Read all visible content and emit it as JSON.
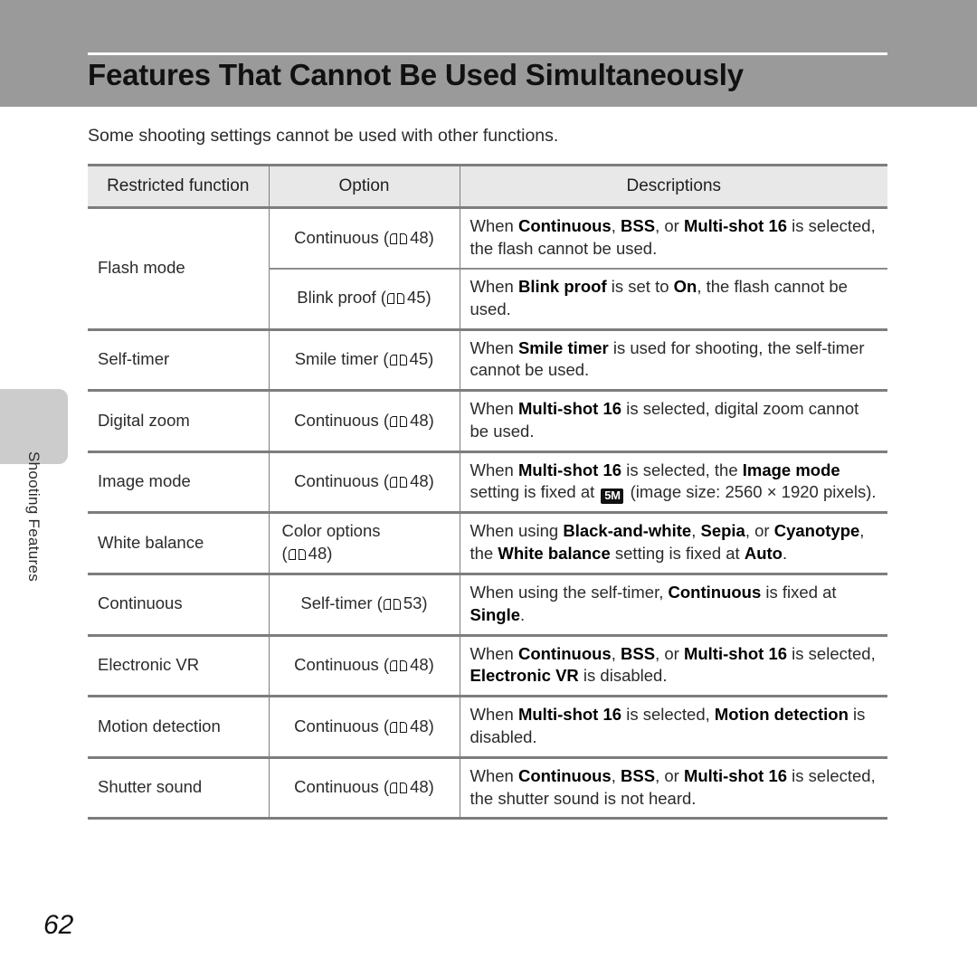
{
  "header": {
    "title": "Features That Cannot Be Used Simultaneously"
  },
  "intro": "Some shooting settings cannot be used with other functions.",
  "side_tab": {
    "label": "Shooting Features"
  },
  "footer": {
    "page_number": "62"
  },
  "table": {
    "columns": [
      "Restricted function",
      "Option",
      "Descriptions"
    ],
    "rows": [
      {
        "function": "Flash mode",
        "option_prefix": "Continuous (",
        "option_icon": "book-icon",
        "option_page": "48",
        "option_suffix": ")",
        "description_parts": [
          {
            "text": "When ",
            "bold": false
          },
          {
            "text": "Continuous",
            "bold": true
          },
          {
            "text": ", ",
            "bold": false
          },
          {
            "text": "BSS",
            "bold": true
          },
          {
            "text": ", or ",
            "bold": false
          },
          {
            "text": "Multi-shot 16",
            "bold": true
          },
          {
            "text": " is selected, the flash cannot be used.",
            "bold": false
          }
        ]
      },
      {
        "function": "",
        "option_prefix": "Blink proof (",
        "option_icon": "book-icon",
        "option_page": "45",
        "option_suffix": ")",
        "description_parts": [
          {
            "text": "When ",
            "bold": false
          },
          {
            "text": "Blink proof",
            "bold": true
          },
          {
            "text": " is set to ",
            "bold": false
          },
          {
            "text": "On",
            "bold": true
          },
          {
            "text": ", the flash cannot be used.",
            "bold": false
          }
        ]
      },
      {
        "function": "Self-timer",
        "option_prefix": "Smile timer (",
        "option_icon": "book-icon",
        "option_page": "45",
        "option_suffix": ")",
        "description_parts": [
          {
            "text": "When ",
            "bold": false
          },
          {
            "text": "Smile timer",
            "bold": true
          },
          {
            "text": " is used for shooting, the self-timer cannot be used.",
            "bold": false
          }
        ]
      },
      {
        "function": "Digital zoom",
        "option_prefix": "Continuous (",
        "option_icon": "book-icon",
        "option_page": "48",
        "option_suffix": ")",
        "description_parts": [
          {
            "text": "When ",
            "bold": false
          },
          {
            "text": "Multi-shot 16",
            "bold": true
          },
          {
            "text": " is selected, digital zoom cannot be used.",
            "bold": false
          }
        ]
      },
      {
        "function": "Image mode",
        "option_prefix": "Continuous (",
        "option_icon": "book-icon",
        "option_page": "48",
        "option_suffix": ")",
        "description_parts": [
          {
            "text": "When ",
            "bold": false
          },
          {
            "text": "Multi-shot 16",
            "bold": true
          },
          {
            "text": " is selected, the ",
            "bold": false
          },
          {
            "text": "Image mode",
            "bold": true
          },
          {
            "text": " setting is fixed at ",
            "bold": false
          },
          {
            "badge": "5M"
          },
          {
            "text": " (image size: 2560 × 1920 pixels).",
            "bold": false
          }
        ]
      },
      {
        "function": "White balance",
        "option_prefix": "Color options",
        "option_icon": "book-icon",
        "option_page": "48",
        "option_suffix": "",
        "option_wrapped": true,
        "description_parts": [
          {
            "text": "When using ",
            "bold": false
          },
          {
            "text": "Black-and-white",
            "bold": true
          },
          {
            "text": ", ",
            "bold": false
          },
          {
            "text": "Sepia",
            "bold": true
          },
          {
            "text": ", or ",
            "bold": false
          },
          {
            "text": "Cyanotype",
            "bold": true
          },
          {
            "text": ", the ",
            "bold": false
          },
          {
            "text": "White balance",
            "bold": true
          },
          {
            "text": " setting is fixed at ",
            "bold": false
          },
          {
            "text": "Auto",
            "bold": true
          },
          {
            "text": ".",
            "bold": false
          }
        ]
      },
      {
        "function": "Continuous",
        "option_prefix": "Self-timer (",
        "option_icon": "book-icon",
        "option_page": "53",
        "option_suffix": ")",
        "description_parts": [
          {
            "text": "When using the self-timer, ",
            "bold": false
          },
          {
            "text": "Continuous",
            "bold": true
          },
          {
            "text": " is fixed at ",
            "bold": false
          },
          {
            "text": "Single",
            "bold": true
          },
          {
            "text": ".",
            "bold": false
          }
        ]
      },
      {
        "function": "Electronic VR",
        "option_prefix": "Continuous (",
        "option_icon": "book-icon",
        "option_page": "48",
        "option_suffix": ")",
        "description_parts": [
          {
            "text": "When ",
            "bold": false
          },
          {
            "text": "Continuous",
            "bold": true
          },
          {
            "text": ", ",
            "bold": false
          },
          {
            "text": "BSS",
            "bold": true
          },
          {
            "text": ", or ",
            "bold": false
          },
          {
            "text": "Multi-shot 16",
            "bold": true
          },
          {
            "text": " is selected, ",
            "bold": false
          },
          {
            "text": "Electronic VR",
            "bold": true
          },
          {
            "text": " is disabled.",
            "bold": false
          }
        ]
      },
      {
        "function": "Motion detection",
        "option_prefix": "Continuous (",
        "option_icon": "book-icon",
        "option_page": "48",
        "option_suffix": ")",
        "description_parts": [
          {
            "text": "When ",
            "bold": false
          },
          {
            "text": "Multi-shot 16",
            "bold": true
          },
          {
            "text": " is selected, ",
            "bold": false
          },
          {
            "text": "Motion detection",
            "bold": true
          },
          {
            "text": " is disabled.",
            "bold": false
          }
        ]
      },
      {
        "function": "Shutter sound",
        "option_prefix": "Continuous (",
        "option_icon": "book-icon",
        "option_page": "48",
        "option_suffix": ")",
        "description_parts": [
          {
            "text": "When ",
            "bold": false
          },
          {
            "text": "Continuous",
            "bold": true
          },
          {
            "text": ", ",
            "bold": false
          },
          {
            "text": "BSS",
            "bold": true
          },
          {
            "text": ", or ",
            "bold": false
          },
          {
            "text": "Multi-shot 16",
            "bold": true
          },
          {
            "text": " is selected, the shutter sound is not heard.",
            "bold": false
          }
        ]
      }
    ]
  },
  "colors": {
    "header_band": "#9a9a9a",
    "table_header_fill": "#e8e8e8",
    "rule": "#7d7d7d",
    "side_tab": "#cccccc"
  }
}
